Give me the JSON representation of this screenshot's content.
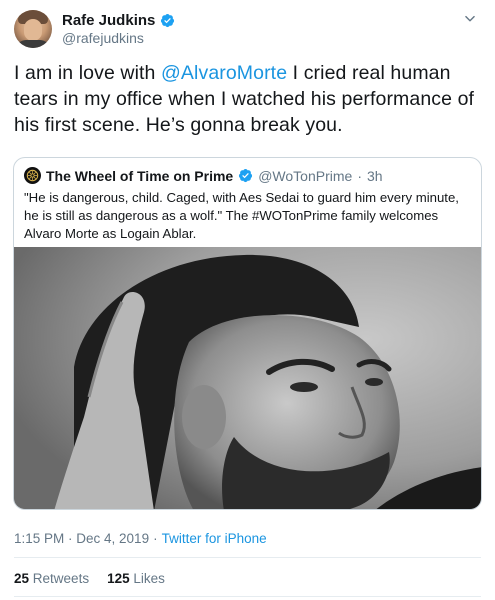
{
  "author": {
    "display_name": "Rafe Judkins",
    "handle": "@rafejudkins"
  },
  "tweet": {
    "text_parts": [
      "I am in love with ",
      "@AlvaroMorte",
      " I cried real human tears in my office when I watched his performance of his first scene. He’s gonna break you."
    ]
  },
  "quoted_tweet": {
    "display_name": "The Wheel of Time on Prime",
    "handle": "@WoTonPrime",
    "separator": "·",
    "time": "3h",
    "text": "\"He is dangerous, child. Caged, with Aes Sedai to guard him every minute, he is still as dangerous as a wolf.\" The #WOTonPrime family welcomes Alvaro Morte as Logain Ablar."
  },
  "meta": {
    "timestamp": "1:15 PM · Dec 4, 2019",
    "separator": "·",
    "source": "Twitter for iPhone"
  },
  "stats": {
    "retweets_count": "25",
    "retweets_label": "Retweets",
    "likes_count": "125",
    "likes_label": "Likes"
  },
  "icons": {
    "verified": "verified-badge-icon",
    "caret": "chevron-down-icon",
    "quote_logo": "wheel-of-time-logo-icon"
  },
  "colors": {
    "link": "#1b95e0",
    "verified": "#1da1f2",
    "secondary_text": "#657786",
    "border": "#ccd6dd"
  }
}
